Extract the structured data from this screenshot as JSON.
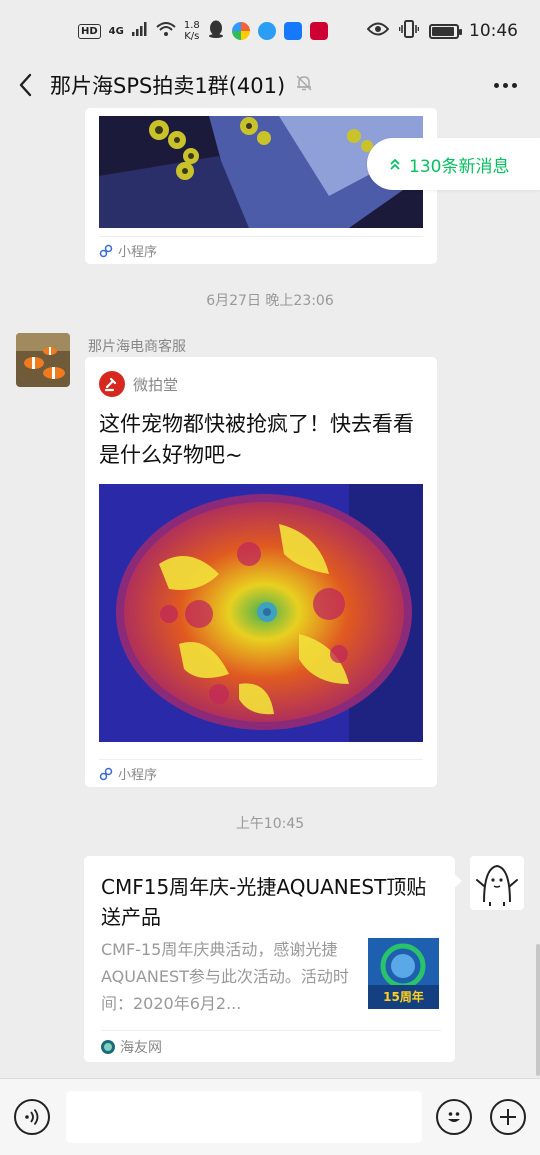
{
  "status_bar": {
    "hd": "HD",
    "network": "4G",
    "speed_value": "1.8",
    "speed_unit": "K/s",
    "time": "10:46",
    "battery_level": 0.9
  },
  "nav": {
    "title": "那片海SPS拍卖1群(401)",
    "icons": [
      "back-arrow-icon",
      "mute-bell-icon",
      "more-icon"
    ]
  },
  "new_messages": {
    "label": "130条新消息"
  },
  "messages": {
    "first_card": {
      "footer_label": "小程序"
    },
    "time_1": "6月27日 晚上23:06",
    "second": {
      "sender": "那片海电商客服",
      "app_name": "微拍堂",
      "text": "这件宠物都快被抢疯了！快去看看是什么好物吧~",
      "footer_label": "小程序"
    },
    "time_2": "上午10:45",
    "third": {
      "title": "CMF15周年庆-光捷AQUANEST顶贴送产品",
      "description": "CMF-15周年庆典活动，感谢光捷AQUANEST参与此次活动。活动时间：2020年6月2...",
      "thumb_text": "15周年",
      "source": "海友网"
    }
  },
  "colors": {
    "accent_green": "#07c160",
    "background": "#ededed",
    "weipaitang_red": "#d7281f"
  }
}
